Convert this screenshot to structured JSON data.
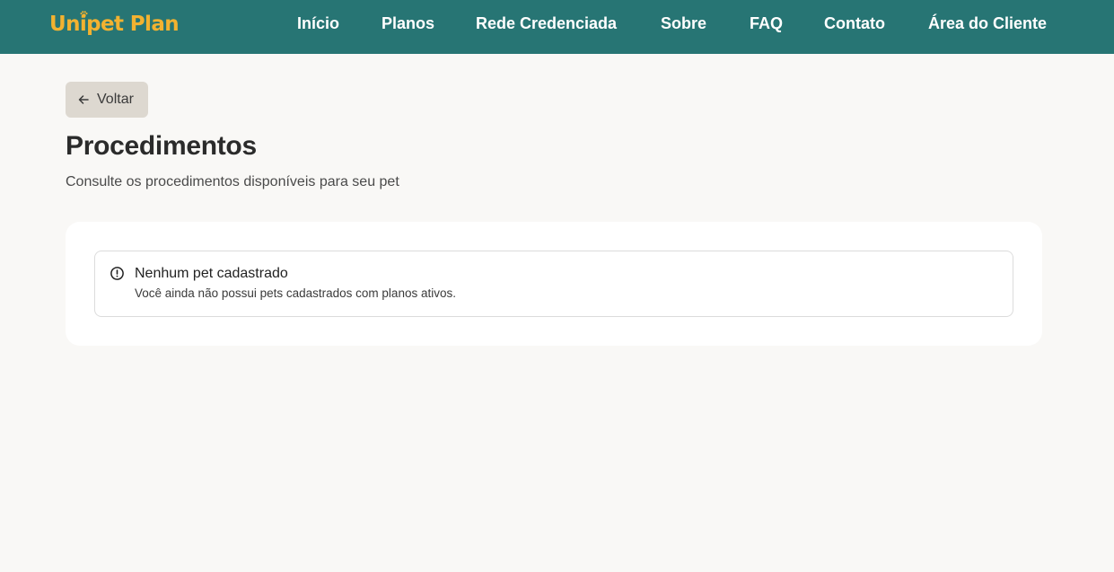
{
  "brand": {
    "name": "Unipet Plan",
    "logo_color": "#f2b230",
    "header_color": "#277574"
  },
  "nav": {
    "items": [
      {
        "label": "Início"
      },
      {
        "label": "Planos"
      },
      {
        "label": "Rede Credenciada"
      },
      {
        "label": "Sobre"
      },
      {
        "label": "FAQ"
      },
      {
        "label": "Contato"
      },
      {
        "label": "Área do Cliente"
      }
    ]
  },
  "back_button": {
    "label": "Voltar",
    "icon": "arrow-left-icon"
  },
  "page": {
    "title": "Procedimentos",
    "subtitle": "Consulte os procedimentos disponíveis para seu pet"
  },
  "alert": {
    "icon": "alert-circle-icon",
    "title": "Nenhum pet cadastrado",
    "description": "Você ainda não possui pets cadastrados com planos ativos."
  }
}
